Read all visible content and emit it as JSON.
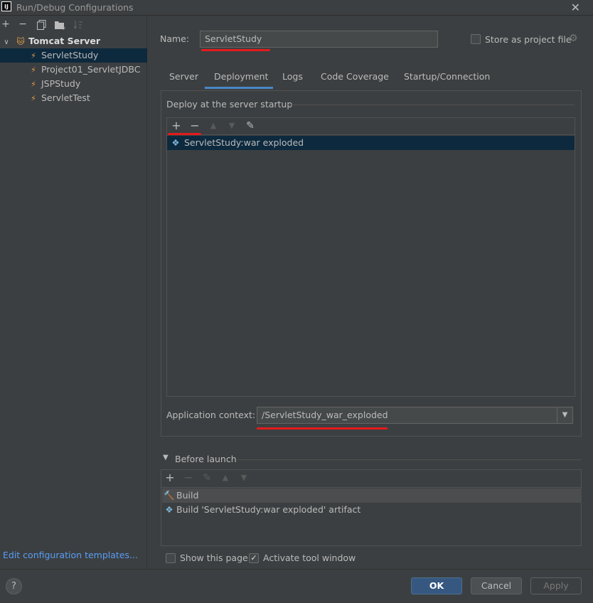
{
  "window": {
    "title": "Run/Debug Configurations",
    "app_badge": "IJ"
  },
  "toolbar": {
    "add": "+",
    "remove": "−"
  },
  "tree": {
    "group": "Tomcat Server",
    "items": [
      "ServletStudy",
      "Project01_ServletJDBC",
      "JSPStudy",
      "ServletTest"
    ],
    "selected": "ServletStudy"
  },
  "name_field": {
    "label": "Name:",
    "value": "ServletStudy"
  },
  "store_project": {
    "label": "Store as project file",
    "checked": false
  },
  "tabs": [
    "Server",
    "Deployment",
    "Logs",
    "Code Coverage",
    "Startup/Connection"
  ],
  "active_tab": "Deployment",
  "deploy": {
    "section_title": "Deploy at the server startup",
    "items": [
      "ServletStudy:war exploded"
    ]
  },
  "app_context": {
    "label": "Application context:",
    "value": "/ServletStudy_war_exploded"
  },
  "before_launch": {
    "title": "Before launch",
    "items": [
      "Build",
      "Build 'ServletStudy:war exploded' artifact"
    ]
  },
  "options": {
    "show_page": {
      "label": "Show this page",
      "checked": false
    },
    "activate_tool": {
      "label": "Activate tool window",
      "checked": true
    }
  },
  "footer": {
    "edit_templates": "Edit configuration templates...",
    "help": "?",
    "ok": "OK",
    "cancel": "Cancel",
    "apply": "Apply"
  },
  "colors": {
    "accent": "#4a88c7",
    "selection": "#0d293e",
    "annotation": "#e41b1b",
    "link": "#589df6"
  }
}
